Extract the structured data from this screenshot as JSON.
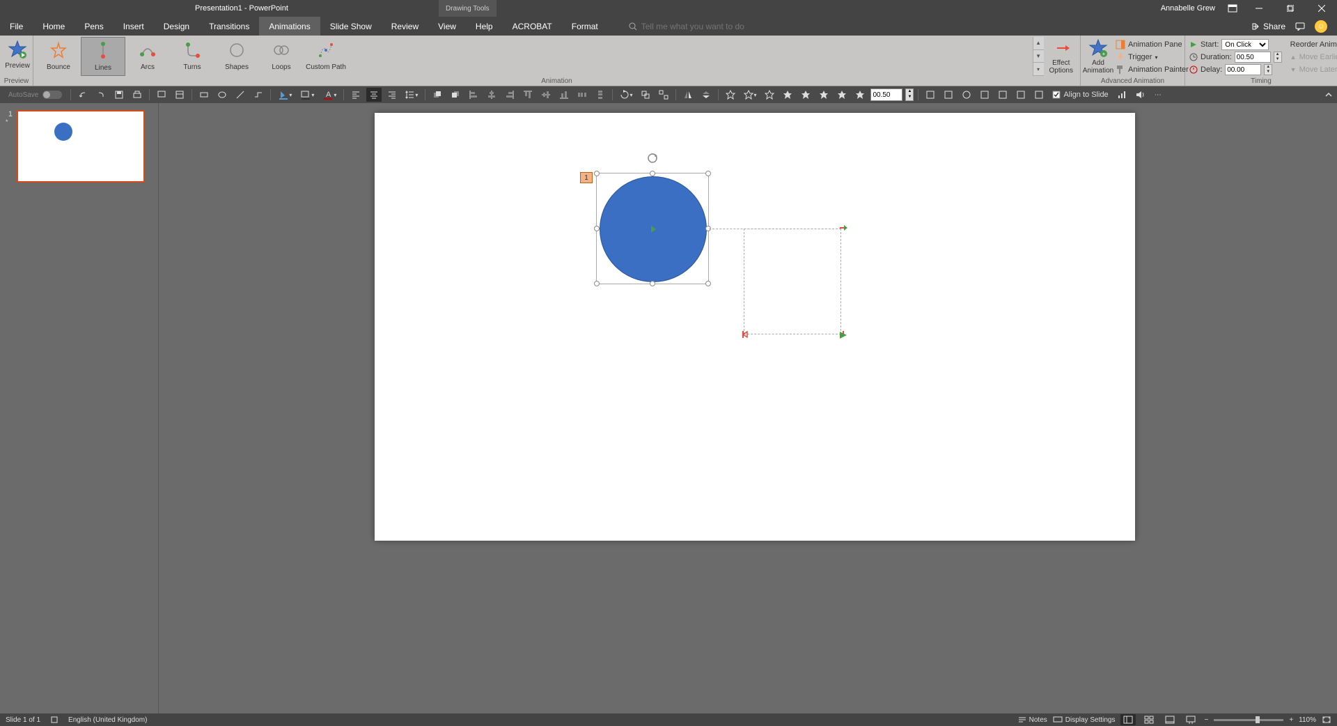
{
  "titlebar": {
    "title": "Presentation1 - PowerPoint",
    "drawing_tools": "Drawing Tools",
    "username": "Annabelle Grew"
  },
  "tabs": {
    "file": "File",
    "home": "Home",
    "pens": "Pens",
    "insert": "Insert",
    "design": "Design",
    "transitions": "Transitions",
    "animations": "Animations",
    "slideshow": "Slide Show",
    "review": "Review",
    "view": "View",
    "help": "Help",
    "acrobat": "ACROBAT",
    "format": "Format",
    "tellme_placeholder": "Tell me what you want to do",
    "share": "Share"
  },
  "ribbon": {
    "preview": {
      "label": "Preview",
      "group": "Preview"
    },
    "animation_group": "Animation",
    "gallery": {
      "bounce": "Bounce",
      "lines": "Lines",
      "arcs": "Arcs",
      "turns": "Turns",
      "shapes": "Shapes",
      "loops": "Loops",
      "custom_path": "Custom Path"
    },
    "effect_options": "Effect\nOptions",
    "advanced_group": "Advanced Animation",
    "add_animation": "Add\nAnimation",
    "animation_pane": "Animation Pane",
    "trigger": "Trigger",
    "animation_painter": "Animation Painter",
    "timing_group": "Timing",
    "start_label": "Start:",
    "start_value": "On Click",
    "duration_label": "Duration:",
    "duration_value": "00.50",
    "delay_label": "Delay:",
    "delay_value": "00.00",
    "reorder": "Reorder Animation",
    "move_earlier": "Move Earlier",
    "move_later": "Move Later"
  },
  "qat": {
    "autosave": "AutoSave",
    "duration_val": "00.50",
    "align_to_slide": "Align to Slide"
  },
  "thumb": {
    "number": "1",
    "star": "*"
  },
  "canvas": {
    "anim_tag": "1"
  },
  "statusbar": {
    "slide": "Slide 1 of 1",
    "language": "English (United Kingdom)",
    "notes": "Notes",
    "display_settings": "Display Settings",
    "zoom": "110%"
  }
}
